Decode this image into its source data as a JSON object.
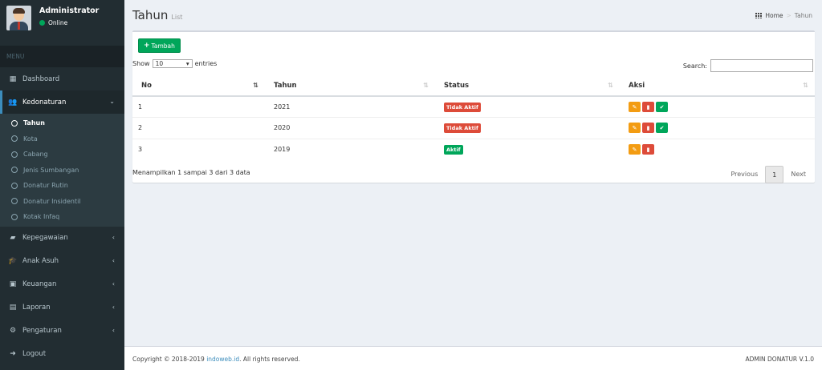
{
  "user": {
    "name": "Administrator",
    "status": "Online"
  },
  "sidebar": {
    "menu_header": "MENU",
    "dashboard": "Dashboard",
    "kedonaturan": "Kedonaturan",
    "subitems": [
      "Tahun",
      "Kota",
      "Cabang",
      "Jenis Sumbangan",
      "Donatur Rutin",
      "Donatur Insidentil",
      "Kotak Infaq"
    ],
    "kepegawaian": "Kepegawaian",
    "anak_asuh": "Anak Asuh",
    "keuangan": "Keuangan",
    "laporan": "Laporan",
    "pengaturan": "Pengaturan",
    "logout": "Logout"
  },
  "header": {
    "title": "Tahun",
    "subtitle": "List",
    "breadcrumb_home": "Home",
    "breadcrumb_current": "Tahun"
  },
  "toolbar": {
    "add_label": "Tambah",
    "show_label": "Show",
    "entries_value": "10",
    "entries_label": "entries",
    "search_label": "Search:"
  },
  "table": {
    "columns": [
      "No",
      "Tahun",
      "Status",
      "Aksi"
    ],
    "rows": [
      {
        "no": "1",
        "tahun": "2021",
        "status": "Tidak Aktif"
      },
      {
        "no": "2",
        "tahun": "2020",
        "status": "Tidak Aktif"
      },
      {
        "no": "3",
        "tahun": "2019",
        "status": "Aktif"
      }
    ]
  },
  "pagination": {
    "info": "Menampilkan 1 sampai 3 dari 3 data",
    "previous": "Previous",
    "current": "1",
    "next": "Next"
  },
  "footer": {
    "copyright_prefix": "Copyright © 2018-2019 ",
    "link": "indoweb.id",
    "copyright_suffix": ". All rights reserved.",
    "version": "ADMIN DONATUR V.1.0"
  },
  "colors": {
    "sidebar": "#222d32",
    "primary": "#3c8dbc",
    "success": "#00a65a",
    "danger": "#dd4b39",
    "warning": "#f39c12"
  }
}
